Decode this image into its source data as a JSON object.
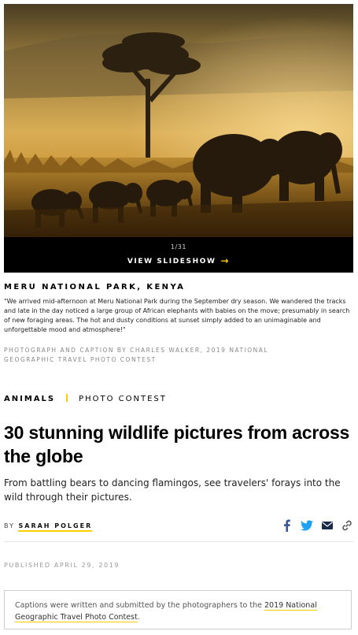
{
  "hero": {
    "image_alt": "Elephants walking through golden grass at sunset",
    "slide_count": "1/31",
    "slideshow_label": "VIEW SLIDESHOW",
    "slideshow_arrow": "→"
  },
  "photo": {
    "location": "MERU NATIONAL PARK, KENYA",
    "caption": "\"We arrived mid-afternoon at Meru National Park during the September dry season. We wandered the tracks and late in the day noticed a large group of African elephants with babies on the move; presumably in search of new foraging areas. The hot and dusty conditions at sunset simply added to an unimaginable and unforgettable mood and atmosphere!\"",
    "credit": "PHOTOGRAPH AND CAPTION BY CHARLES WALKER, 2019 NATIONAL GEOGRAPHIC TRAVEL PHOTO CONTEST"
  },
  "tags": {
    "primary": "ANIMALS",
    "secondary": "PHOTO CONTEST"
  },
  "article": {
    "headline": "30 stunning wildlife pictures from across the globe",
    "dek": "From battling bears to dancing flamingos, see travelers' forays into the wild through their pictures.",
    "byline_prefix": "BY",
    "author": "SARAH POLGER",
    "published": "PUBLISHED APRIL 29, 2019"
  },
  "share_icons": [
    "facebook-icon",
    "twitter-icon",
    "email-icon",
    "link-icon"
  ],
  "note": {
    "text_before": "Captions were written and submitted by the photographers to the ",
    "link_text": "2019 National Geographic Travel Photo Contest",
    "text_after": "."
  },
  "colors": {
    "accent": "#ffcc00",
    "twitter": "#1da1f2",
    "facebook": "#3b5998",
    "dark": "#000000"
  }
}
